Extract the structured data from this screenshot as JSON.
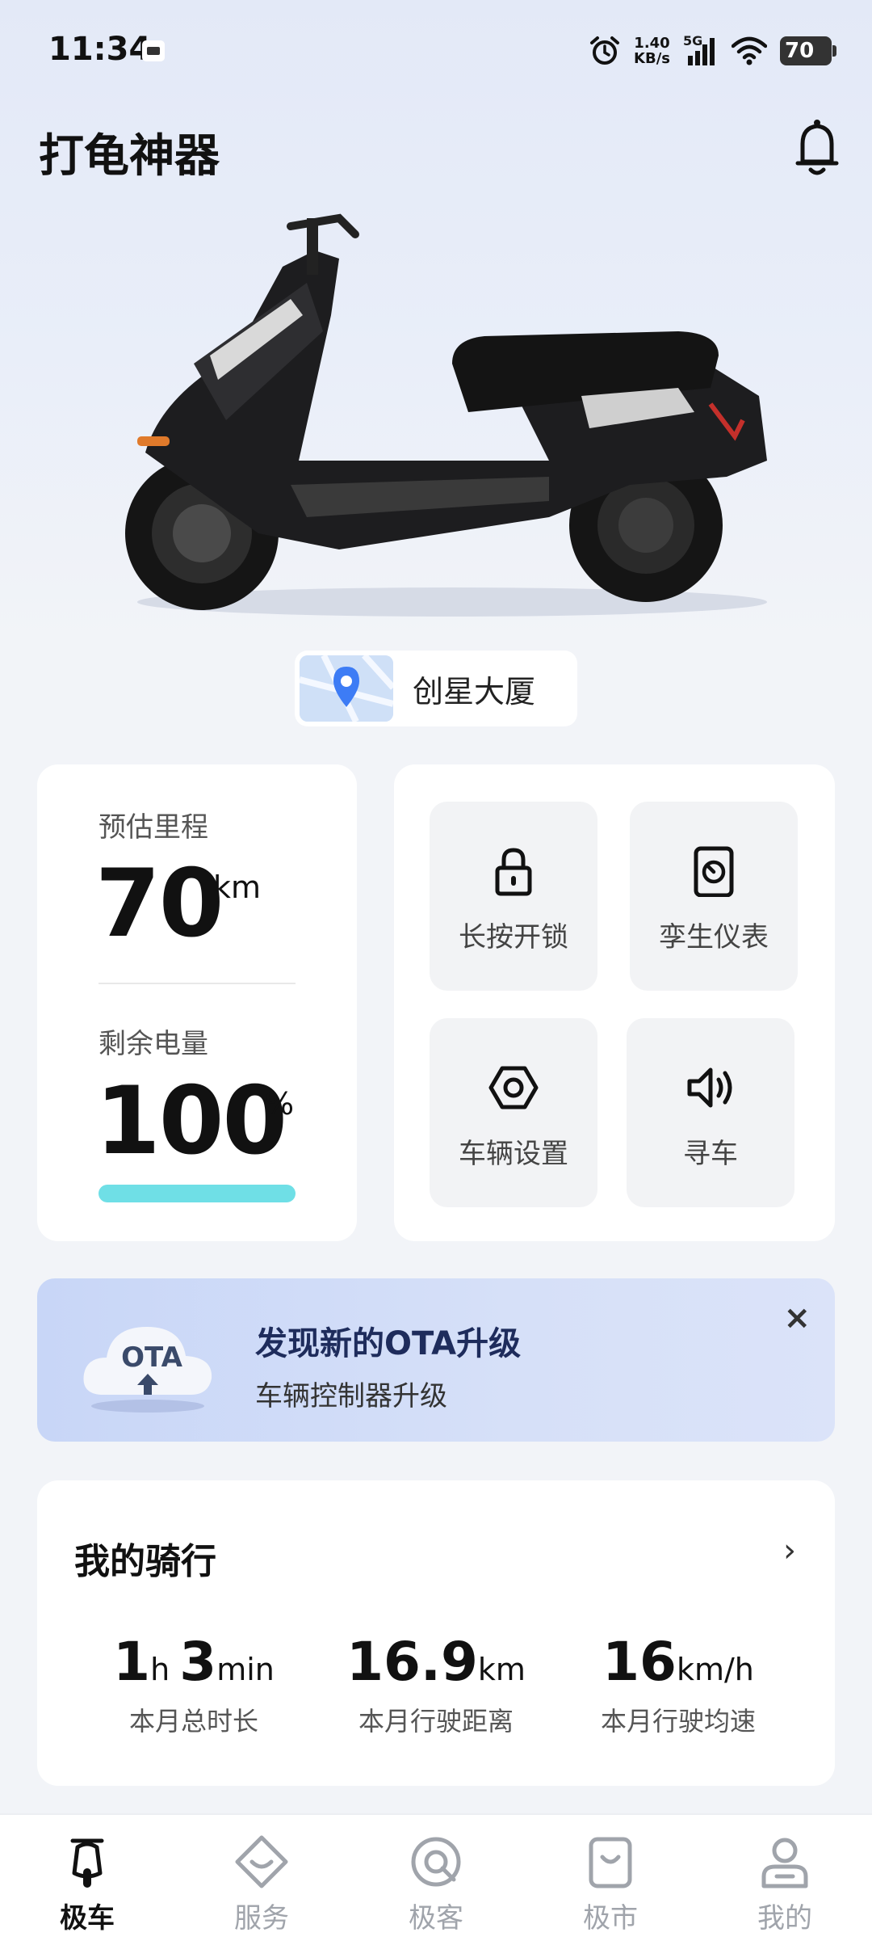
{
  "status_bar": {
    "time": "11:34",
    "net_speed_value": "1.40",
    "net_speed_unit": "KB/s",
    "signal": "5G",
    "battery": "70"
  },
  "header": {
    "title": "打龟神器"
  },
  "location": {
    "name": "创星大厦"
  },
  "range": {
    "label": "预估里程",
    "value": "70",
    "unit": "km"
  },
  "battery_level": {
    "label": "剩余电量",
    "value": "100",
    "unit": "%",
    "fraction": 1.0
  },
  "controls": [
    {
      "label": "长按开锁",
      "icon": "lock-icon"
    },
    {
      "label": "孪生仪表",
      "icon": "dashboard-icon"
    },
    {
      "label": "车辆设置",
      "icon": "settings-hex-icon"
    },
    {
      "label": "寻车",
      "icon": "speaker-icon"
    }
  ],
  "ota": {
    "badge": "OTA",
    "title": "发现新的OTA升级",
    "subtitle": "车辆控制器升级",
    "close": "×"
  },
  "ride": {
    "title": "我的骑行",
    "arrow": "›",
    "stats": [
      {
        "v1": "1",
        "u1": "h",
        "v2": "3",
        "u2": "min",
        "label": "本月总时长"
      },
      {
        "v1": "16.9",
        "u1": "km",
        "label": "本月行驶距离"
      },
      {
        "v1": "16",
        "u1": "km/h",
        "label": "本月行驶均速"
      }
    ]
  },
  "tabs": [
    {
      "label": "极车",
      "active": true
    },
    {
      "label": "服务"
    },
    {
      "label": "极客"
    },
    {
      "label": "极市"
    },
    {
      "label": "我的"
    }
  ],
  "colors": {
    "accent": "#6fdfe6",
    "ota_bg": "#c8d6f7",
    "ota_title": "#1e2c5c"
  }
}
